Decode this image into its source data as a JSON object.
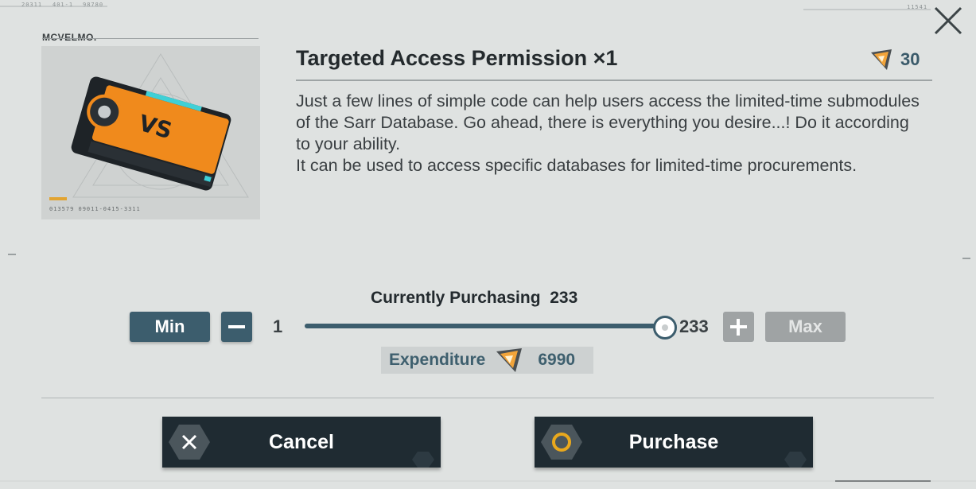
{
  "header": {
    "top_codes": [
      "20311",
      "401-1",
      "98780",
      "11541"
    ],
    "brand": "MCVELMO."
  },
  "item": {
    "image_caption_code": "013579 09011-0415-3311",
    "title": "Targeted Access Permission ×1",
    "price": "30",
    "description": [
      "Just a few lines of simple code can help users access the limited-time submodules of the Sarr Database. Go ahead, there is everything you desire...! Do it according to your ability.",
      "It can be used to access specific databases for limited-time procurements."
    ]
  },
  "quantity": {
    "label": "Currently Purchasing",
    "current": "233",
    "min_label": "Min",
    "max_label": "Max",
    "min_value": "1",
    "max_value": "233",
    "slider_fraction": 1.0
  },
  "expenditure": {
    "label": "Expenditure",
    "amount": "6990"
  },
  "actions": {
    "cancel_label": "Cancel",
    "purchase_label": "Purchase"
  },
  "colors": {
    "accent": "#3c5d6d",
    "disabled": "#9fa3a4",
    "button_dark": "#1f2b32",
    "purchase_ring": "#e9a81d",
    "card_orange": "#f08a1c"
  }
}
